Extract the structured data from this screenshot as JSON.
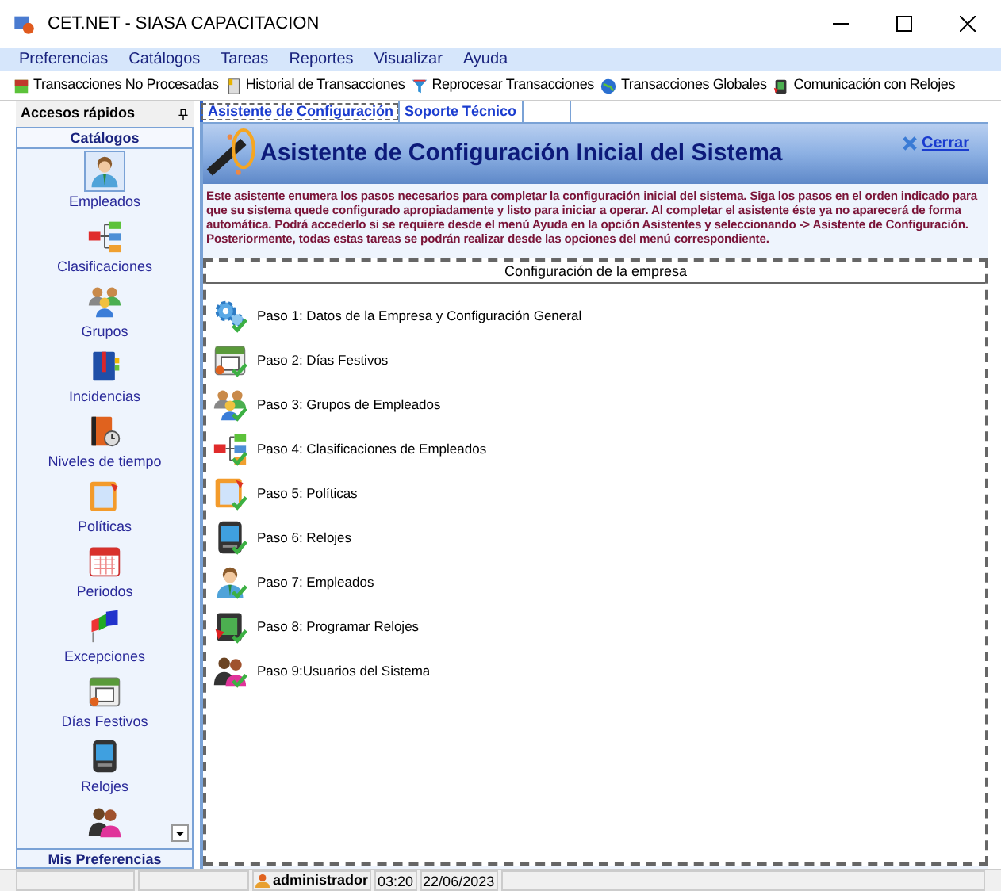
{
  "window": {
    "title": "CET.NET - SIASA CAPACITACION"
  },
  "menu": [
    "Preferencias",
    "Catálogos",
    "Tareas",
    "Reportes",
    "Visualizar",
    "Ayuda"
  ],
  "toolbar": [
    "Transacciones No Procesadas",
    "Historial de Transacciones",
    "Reprocesar Transacciones",
    "Transacciones Globales",
    "Comunicación con Relojes"
  ],
  "sidebar": {
    "title": "Accesos rápidos",
    "section": "Catálogos",
    "footer": "Mis Preferencias",
    "items": [
      {
        "label": "Empleados",
        "selected": true
      },
      {
        "label": "Clasificaciones",
        "selected": false
      },
      {
        "label": "Grupos",
        "selected": false
      },
      {
        "label": "Incidencias",
        "selected": false
      },
      {
        "label": "Niveles de tiempo",
        "selected": false
      },
      {
        "label": "Políticas",
        "selected": false
      },
      {
        "label": "Periodos",
        "selected": false
      },
      {
        "label": "Excepciones",
        "selected": false
      },
      {
        "label": "Días Festivos",
        "selected": false
      },
      {
        "label": "Relojes",
        "selected": false
      },
      {
        "selected": false
      }
    ]
  },
  "tabs": [
    {
      "label": "Asistente de Configuración",
      "selected": true
    },
    {
      "label": "Soporte Técnico",
      "selected": false
    }
  ],
  "wizard": {
    "title": "Asistente de Configuración Inicial del Sistema",
    "close": "Cerrar",
    "description": "Este asistente enumera los pasos necesarios para completar la configuración inicial del sistema. Siga los pasos en el orden indicado para que su sistema quede configurado apropiadamente y listo para iniciar a operar. Al completar el asistente éste ya no aparecerá de forma automática. Podrá accederlo si se requiere desde el menú Ayuda en la opción Asistentes y seleccionando -> Asistente de Configuración. Posteriormente, todas estas tareas se podrán realizar desde las opciones del menú correspondiente.",
    "panel_title": "Configuración de la empresa",
    "steps": [
      "Paso 1: Datos de la Empresa y Configuración General",
      "Paso 2: Días Festivos",
      "Paso 3: Grupos de Empleados",
      "Paso 4: Clasificaciones de Empleados",
      "Paso 5: Políticas",
      "Paso 6: Relojes",
      "Paso 7: Empleados",
      "Paso 8: Programar Relojes",
      "Paso 9:Usuarios del Sistema"
    ]
  },
  "status_bar": {
    "user": "administrador",
    "time": "03:20",
    "date": "22/06/2023"
  }
}
